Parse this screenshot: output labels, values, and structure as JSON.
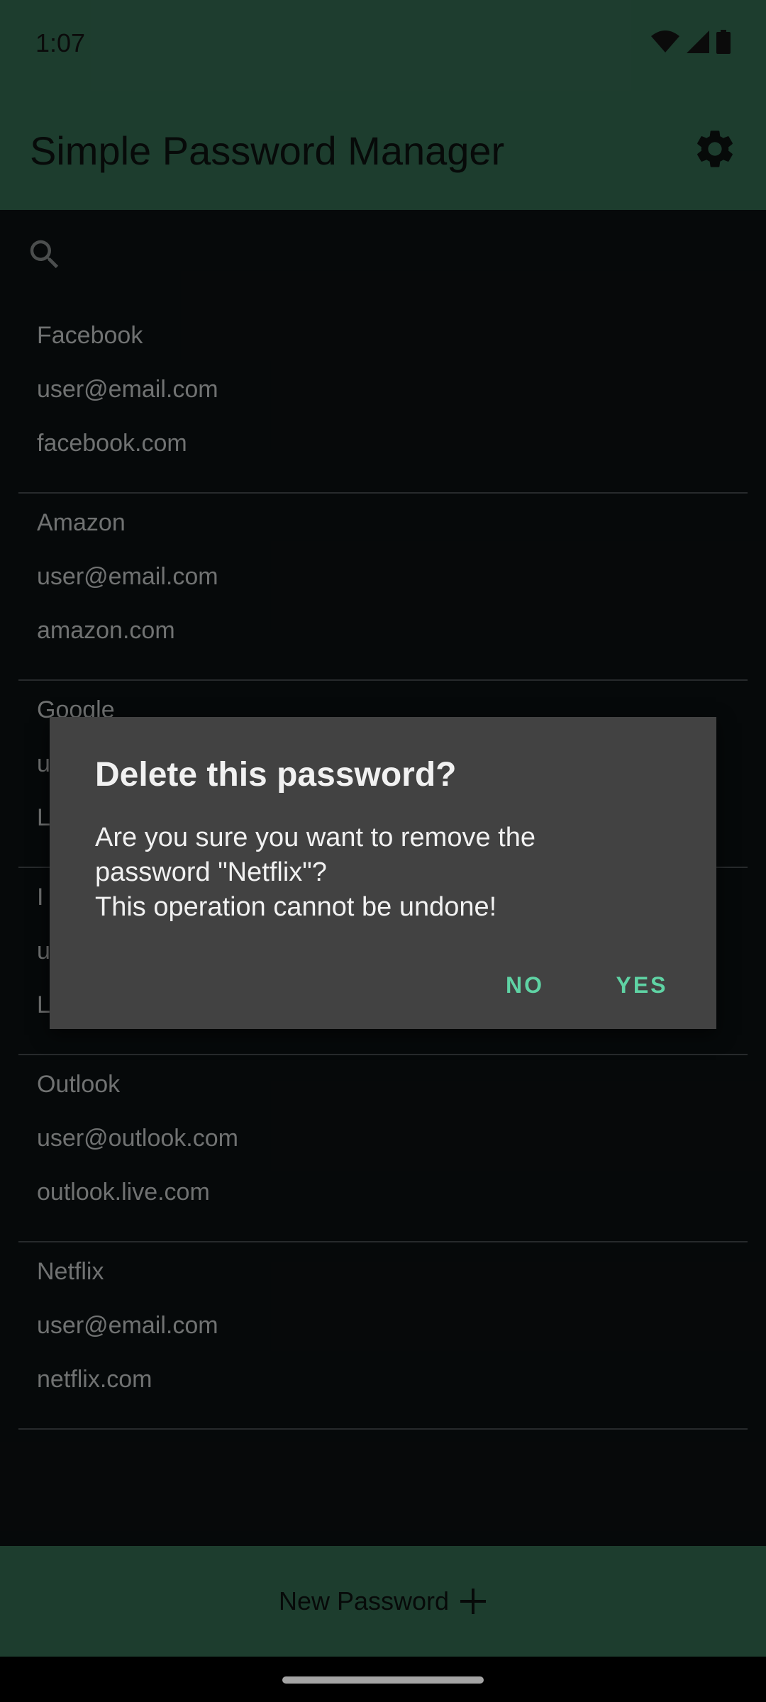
{
  "status_bar": {
    "time": "1:07"
  },
  "app_bar": {
    "title": "Simple Password Manager",
    "settings_icon": "gear-icon"
  },
  "search": {
    "icon": "search-icon"
  },
  "passwords": [
    {
      "name": "Facebook",
      "username": "user@email.com",
      "url": "facebook.com"
    },
    {
      "name": "Amazon",
      "username": "user@email.com",
      "url": "amazon.com"
    },
    {
      "name": "Google",
      "username": "u",
      "url": "L"
    },
    {
      "name": "I",
      "username": "u",
      "url": "L"
    },
    {
      "name": "Outlook",
      "username": "user@outlook.com",
      "url": "outlook.live.com"
    },
    {
      "name": "Netflix",
      "username": "user@email.com",
      "url": "netflix.com"
    }
  ],
  "dialog": {
    "title": "Delete this password?",
    "message": "Are you sure you want to remove the\npassword \"Netflix\"?\nThis operation cannot be undone!",
    "no_label": "NO",
    "yes_label": "YES"
  },
  "bottom_button": {
    "label": "New Password",
    "icon": "plus-icon"
  },
  "colors": {
    "primary": "#2c5a45",
    "background": "#0a0e0f",
    "dialog_bg": "#424242",
    "accent": "#5fd3a4"
  }
}
